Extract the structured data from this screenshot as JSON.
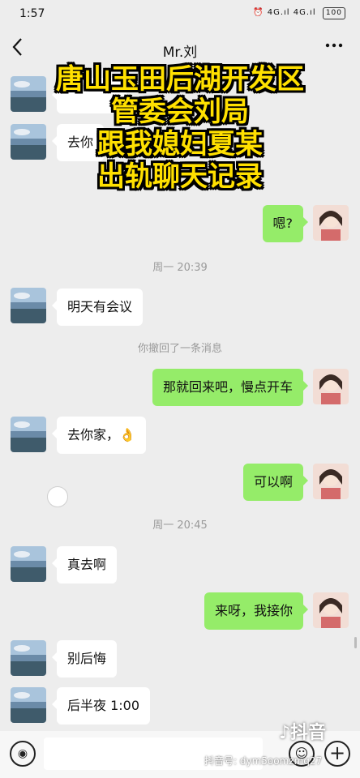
{
  "status_bar": {
    "time": "1:57",
    "right_text": "⏰ 4G.ıl 4G.ıl",
    "battery": "100"
  },
  "chat": {
    "title": "Mr.刘",
    "back_icon": "chevron-left-icon",
    "more_icon": "more-dots-icon"
  },
  "overlay_caption": [
    "唐山玉田后湖开发区",
    "管委会刘局",
    "跟我媳妇夏某",
    "出轨聊天记录"
  ],
  "messages": [
    {
      "side": "in",
      "text": "去你"
    },
    {
      "side": "out",
      "text": "嗯?"
    },
    {
      "side": "time",
      "text": "周一 20:39"
    },
    {
      "side": "in",
      "text": "明天有会议"
    },
    {
      "side": "system",
      "text": "你撤回了一条消息"
    },
    {
      "side": "out",
      "text": "那就回来吧，慢点开车"
    },
    {
      "side": "in",
      "text": "去你家，👌"
    },
    {
      "side": "out",
      "text": "可以啊"
    },
    {
      "side": "time",
      "text": "周一 20:45"
    },
    {
      "side": "in",
      "text": "真去啊"
    },
    {
      "side": "out",
      "text": "来呀，我接你"
    },
    {
      "side": "in",
      "text": "别后悔"
    },
    {
      "side": "in",
      "text": "后半夜 1:00"
    }
  ],
  "input_bar": {
    "voice_icon": "voice-icon",
    "emoji_icon": "emoji-icon",
    "plus_icon": "plus-icon"
  },
  "watermark": {
    "logo": "♪抖音",
    "account": "抖音号: dym5oomzmq27"
  }
}
